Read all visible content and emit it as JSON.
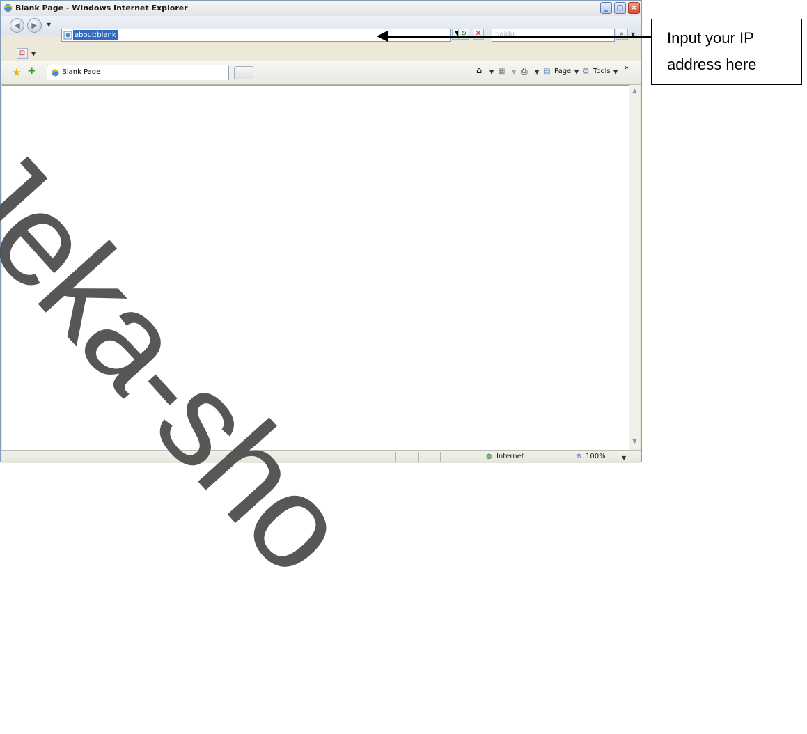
{
  "window": {
    "title": "Blank Page - Windows Internet Explorer",
    "minimize_label": "_",
    "maximize_label": "□",
    "close_label": "×"
  },
  "navigation": {
    "back_icon": "back-arrow-icon",
    "forward_icon": "forward-arrow-icon",
    "address_value": "about:blank",
    "search_placeholder": "baidu"
  },
  "tabs": [
    {
      "label": "Blank Page"
    }
  ],
  "command_bar": {
    "page_label": "Page",
    "tools_label": "Tools"
  },
  "status_bar": {
    "zone": "Internet",
    "zoom": "100%"
  },
  "annotation": {
    "line1": "Input your IP",
    "line2": "address here"
  },
  "watermark": {
    "text": "Jeka-sho"
  },
  "colors": {
    "window_frame": "#7f9db9",
    "url_highlight": "#316ac5",
    "close_button": "#d64a2b"
  }
}
